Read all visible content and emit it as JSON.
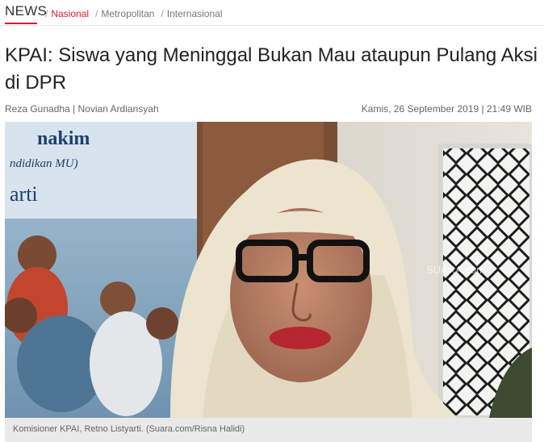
{
  "section": {
    "label": "NEWS",
    "breadcrumbs": [
      {
        "label": "Nasional",
        "active": true
      },
      {
        "label": "Metropolitan",
        "active": false
      },
      {
        "label": "Internasional",
        "active": false
      }
    ],
    "separator": "/"
  },
  "article": {
    "title": "KPAI: Siswa yang Meninggal Bukan Mau ataupun Pulang Aksi di DPR",
    "authors": "Reza Gunadha | Novian Ardiansyah",
    "published": "Kamis, 26 September 2019 | 21:49 WIB",
    "photo": {
      "banner_text_1": "nakim",
      "banner_text_2": "ndidikan MU)",
      "banner_text_3": "arti",
      "watermark": "SUARA.com"
    },
    "caption": "Komisioner KPAI, Retno Listyarti. (Suara.com/Risna Halidi)"
  },
  "colors": {
    "accent": "#d7202b",
    "hijab": "#ece4cf",
    "banner": "#8fb2cc"
  }
}
